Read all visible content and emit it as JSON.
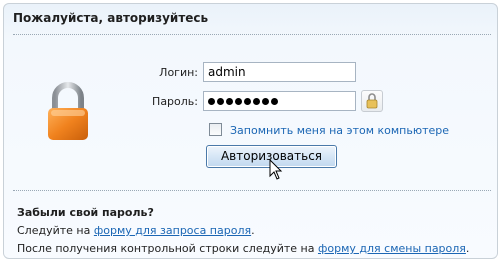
{
  "panel": {
    "title": "Пожалуйста, авторизуйтесь"
  },
  "form": {
    "login_label": "Логин:",
    "login_value": "admin",
    "password_label": "Пароль:",
    "password_length": 8,
    "remember_label": "Запомнить меня на этом компьютере",
    "submit_label": "Авторизоваться"
  },
  "forgot": {
    "title": "Забыли свой пароль?",
    "line1_prefix": "Следуйте на ",
    "line1_link": "форму для запроса пароля",
    "line1_suffix": ".",
    "line2_prefix": "После получения контрольной строки следуйте на ",
    "line2_link": "форму для смены пароля",
    "line2_suffix": "."
  },
  "icons": {
    "big_lock": "padlock-icon",
    "keyboard": "keyboard-lock-icon",
    "cursor": "mouse-pointer-icon"
  },
  "colors": {
    "link": "#1b66b4",
    "lock_body": "#f0821e",
    "button_border": "#4a79a9"
  }
}
